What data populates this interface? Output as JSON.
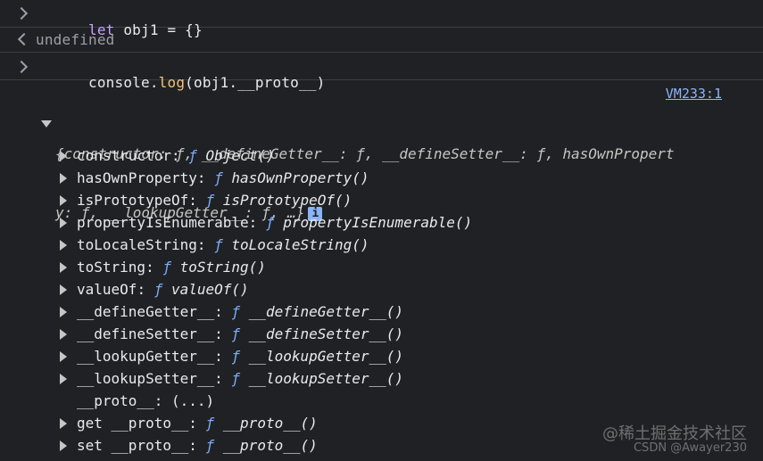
{
  "console": {
    "input1": {
      "keyword": "let",
      "rest": " obj1 = {}"
    },
    "output1": "undefined",
    "input2": {
      "prefix": "console.",
      "method": "log",
      "rest": "(obj1.__proto__)"
    },
    "source_link": "VM233:1",
    "summary_line1": "{constructor: ƒ, __defineGetter__: ƒ, __defineSetter__: ƒ, hasOwnPropert",
    "summary_line2": "y: ƒ, __lookupGetter__: ƒ, …}",
    "info_icon_text": "i",
    "entries": [
      {
        "name": "constructor",
        "fmark": "ƒ",
        "sig": "Object()",
        "expandable": true
      },
      {
        "name": "hasOwnProperty",
        "fmark": "ƒ",
        "sig": "hasOwnProperty()",
        "expandable": true
      },
      {
        "name": "isPrototypeOf",
        "fmark": "ƒ",
        "sig": "isPrototypeOf()",
        "expandable": true
      },
      {
        "name": "propertyIsEnumerable",
        "fmark": "ƒ",
        "sig": "propertyIsEnumerable()",
        "expandable": true
      },
      {
        "name": "toLocaleString",
        "fmark": "ƒ",
        "sig": "toLocaleString()",
        "expandable": true
      },
      {
        "name": "toString",
        "fmark": "ƒ",
        "sig": "toString()",
        "expandable": true
      },
      {
        "name": "valueOf",
        "fmark": "ƒ",
        "sig": "valueOf()",
        "expandable": true
      },
      {
        "name": "__defineGetter__",
        "fmark": "ƒ",
        "sig": "__defineGetter__()",
        "expandable": true
      },
      {
        "name": "__defineSetter__",
        "fmark": "ƒ",
        "sig": "__defineSetter__()",
        "expandable": true
      },
      {
        "name": "__lookupGetter__",
        "fmark": "ƒ",
        "sig": "__lookupGetter__()",
        "expandable": true
      },
      {
        "name": "__lookupSetter__",
        "fmark": "ƒ",
        "sig": "__lookupSetter__()",
        "expandable": true
      },
      {
        "name": "__proto__",
        "fmark": "",
        "sig": "(...)",
        "expandable": false
      },
      {
        "name": "get __proto__",
        "fmark": "ƒ",
        "sig": "__proto__()",
        "expandable": true
      },
      {
        "name": "set __proto__",
        "fmark": "ƒ",
        "sig": "__proto__()",
        "expandable": true
      }
    ]
  },
  "watermark": {
    "line1": "@稀土掘金技术社区",
    "line2": "CSDN @Awayer230"
  },
  "colors": {
    "background": "#202124",
    "keyword": "#c5a5ff",
    "method": "#f2c37a",
    "function_mark": "#7cacf8",
    "link": "#8ab4f8"
  }
}
